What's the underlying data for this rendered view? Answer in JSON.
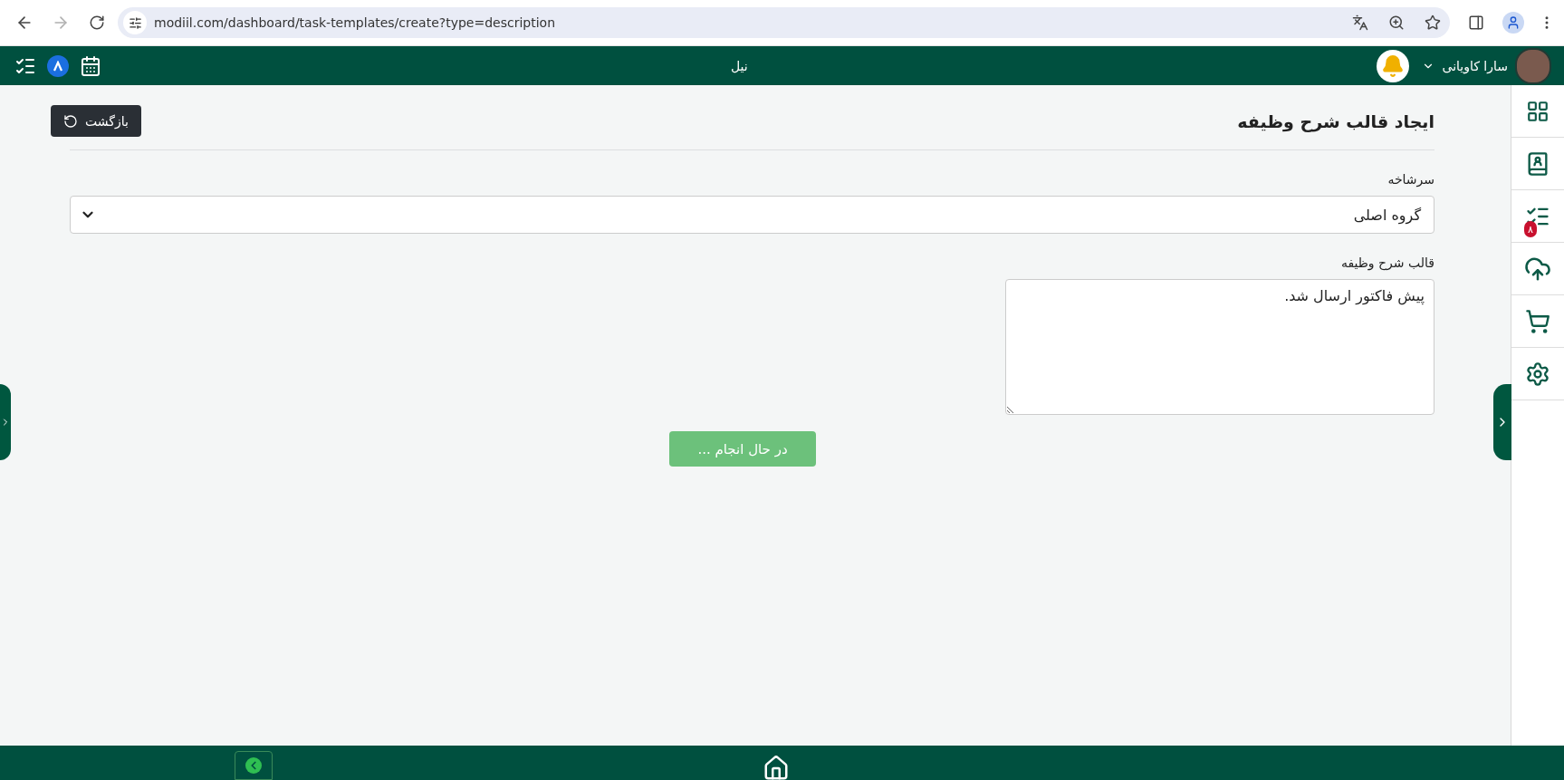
{
  "browser": {
    "url": "modiil.com/dashboard/task-templates/create?type=description",
    "forward": {
      "disabled": true
    }
  },
  "header": {
    "title": "نیل",
    "user": {
      "name": "سارا کاویانی"
    }
  },
  "page": {
    "title": "ایجاد قالب شرح وظیفه",
    "back_button": "بازگشت",
    "parent_field": {
      "label": "سرشاخه",
      "value": "گروه اصلی"
    },
    "template_field": {
      "label": "قالب شرح وظیفه",
      "value": "پیش فاکتور ارسال شد."
    },
    "submit": {
      "label": "در حال انجام ...",
      "disabled": true
    }
  },
  "sidebar": {
    "items": [
      {
        "kind": "grid"
      },
      {
        "kind": "contacts"
      },
      {
        "kind": "tasks",
        "badge": "۸"
      },
      {
        "kind": "upload"
      },
      {
        "kind": "cart"
      },
      {
        "kind": "settings"
      }
    ]
  }
}
